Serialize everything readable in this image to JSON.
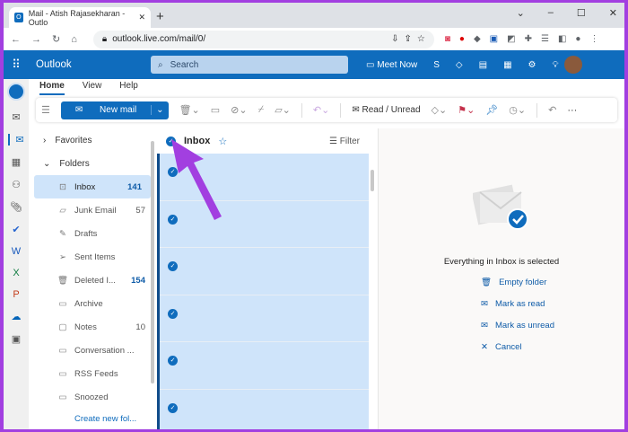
{
  "browser": {
    "tab_title": "Mail - Atish Rajasekharan - Outlo",
    "url": "outlook.live.com/mail/0/"
  },
  "header": {
    "app_name": "Outlook",
    "search_placeholder": "Search",
    "meet_now": "Meet Now"
  },
  "ribbon": {
    "tabs": [
      "Home",
      "View",
      "Help"
    ],
    "new_mail": "New mail",
    "read_unread": "Read / Unread",
    "more": "···"
  },
  "folders": {
    "favorites": "Favorites",
    "folders": "Folders",
    "items": [
      {
        "name": "Inbox",
        "count": "141",
        "icon": "inbox-icon"
      },
      {
        "name": "Junk Email",
        "count": "57",
        "icon": "junk-icon"
      },
      {
        "name": "Drafts",
        "count": "",
        "icon": "drafts-icon"
      },
      {
        "name": "Sent Items",
        "count": "",
        "icon": "send-icon"
      },
      {
        "name": "Deleted I...",
        "count": "154",
        "icon": "trash-icon"
      },
      {
        "name": "Archive",
        "count": "",
        "icon": "archive-icon"
      },
      {
        "name": "Notes",
        "count": "10",
        "icon": "notes-icon"
      },
      {
        "name": "Conversation ...",
        "count": "",
        "icon": "folder-icon"
      },
      {
        "name": "RSS Feeds",
        "count": "",
        "icon": "folder-icon"
      },
      {
        "name": "Snoozed",
        "count": "",
        "icon": "folder-icon"
      }
    ],
    "create_new": "Create new fol..."
  },
  "list": {
    "title": "Inbox",
    "filter": "Filter"
  },
  "reading": {
    "message": "Everything in Inbox is selected",
    "actions": [
      "Empty folder",
      "Mark as read",
      "Mark as unread",
      "Cancel"
    ]
  },
  "colors": {
    "brand": "#0f6cbd",
    "selection": "#cfe4fa",
    "arrow": "#a23fe0"
  }
}
